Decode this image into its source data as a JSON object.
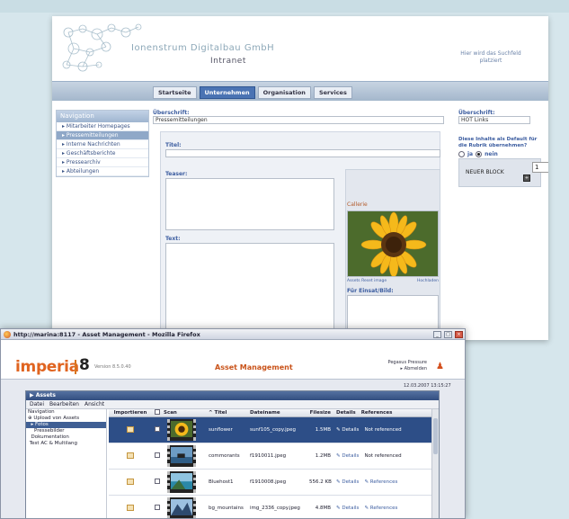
{
  "intranet": {
    "company_name": "Ionenstrum Digitalbau GmbH",
    "subtitle": "Intranet",
    "search_hint_line1": "Hier wird das Suchfeld",
    "search_hint_line2": "platziert",
    "tabs": [
      "Startseite",
      "Unternehmen",
      "Organisation",
      "Services"
    ],
    "active_tab": "Unternehmen",
    "navigation": {
      "heading": "Navigation",
      "items": [
        "Mitarbeiter Homepages",
        "Pressemitteilungen",
        "Interne Nachrichten",
        "Geschäftsberichte",
        "Pressearchiv",
        "Abteilungen"
      ],
      "active_item": "Pressemitteilungen"
    },
    "uberschrift_label": "Überschrift:",
    "uberschrift_value": "Pressemitteilungen",
    "titel_label": "Titel:",
    "teaser_label": "Teaser:",
    "text_label": "Text:",
    "image_caption": "Callerie",
    "image_link_left": "Assets   Reset image",
    "image_link_right": "Hochladen",
    "fuer_label": "Für Einsat/Bild:",
    "hot_label": "Überschrift:",
    "hot_value": "HOT Links",
    "default_text": "Diese Inhalte als Default für die Rubrik übernehmen?",
    "radio_ja": "ja",
    "radio_nein": "nein",
    "new_block_label": "NEUER BLOCK",
    "new_block_value": "1"
  },
  "firefox": {
    "window_title": "http://marina:8117 - Asset Management - Mozilla Firefox"
  },
  "imperia": {
    "brand": "imperia",
    "version_number": "8",
    "version_text": "Version 8.5.0.40",
    "app_title": "Asset Management",
    "user_name": "Pegasus Pressure",
    "user_role": "▸ Abmelden",
    "clock": "12.03.2007 13:15:27",
    "assets_title": "▶ Assets",
    "menu": [
      "Datei",
      "Bearbeiten",
      "Ansicht"
    ],
    "tree": [
      "Navigation",
      "Upload von Assets",
      "▸ Fotos",
      "Pressebilder",
      "Dokumentation",
      "Test AC & Multilang"
    ],
    "columns": [
      "Importieren",
      "",
      "Scan",
      "^ Titel",
      "Dateiname",
      "Filesize",
      "Details",
      "References"
    ],
    "rows": [
      {
        "titel": "sunflower",
        "datei": "sunf105_copy.jpeg",
        "size": "1.5MB",
        "details": "Details",
        "refs": "Not referenced"
      },
      {
        "titel": "commorants",
        "datei": "f1910011.jpeg",
        "size": "1.2MB",
        "details": "Details",
        "refs": "Not referenced"
      },
      {
        "titel": "Bluehost1",
        "datei": "f1910008.jpeg",
        "size": "556.2 KB",
        "details": "Details",
        "refs": "References"
      },
      {
        "titel": "bg_mountains",
        "datei": "img_2336_copy.jpeg",
        "size": "4.8MB",
        "details": "Details",
        "refs": "References"
      }
    ]
  }
}
